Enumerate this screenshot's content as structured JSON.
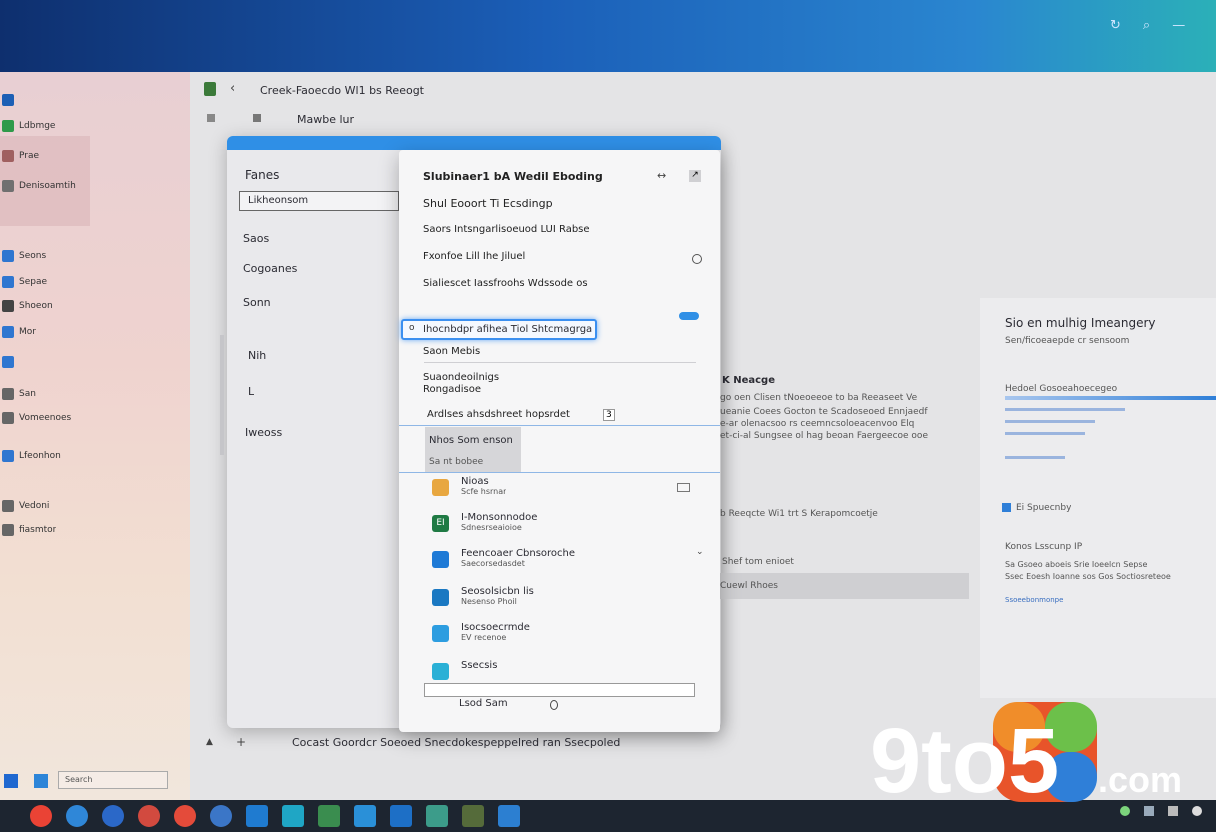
{
  "topbar": {
    "icons": [
      "sync-icon",
      "search-icon",
      "minimize-icon"
    ]
  },
  "left_sidebar": {
    "items": [
      {
        "label": "",
        "color": "#1c5fb5"
      },
      {
        "label": "Ldbmge",
        "color": "#2f9a4a"
      },
      {
        "label": "Prae",
        "color": "#a06060"
      },
      {
        "label": "Denisoamtih",
        "color": "#707070"
      },
      {
        "label": "Seons",
        "color": "#2f76d0"
      },
      {
        "label": "Sepae",
        "color": "#2f76d0"
      },
      {
        "label": "Shoeon",
        "color": "#444"
      },
      {
        "label": "Mor",
        "color": "#2f76d0"
      },
      {
        "label": "",
        "color": "#2f76d0"
      },
      {
        "label": "San",
        "color": "#666"
      },
      {
        "label": "Vomeenoes",
        "color": "#666"
      },
      {
        "label": "Lfeonhon",
        "color": "#2f76d0"
      },
      {
        "label": "Vedoni",
        "color": "#666"
      },
      {
        "label": "fiasmtor",
        "color": "#666"
      }
    ],
    "bottom": {
      "label": "Search",
      "icons": [
        "windows-icon",
        "folder-icon"
      ]
    }
  },
  "window": {
    "address": "Creek-Faoecdo Wl1 bs Reeogt",
    "subnav": "Mawbe lur",
    "status_text": "Cocast Goordcr Soeoed Snecdokespeppelred ran Ssecpoled"
  },
  "settings": {
    "title": "Fanes",
    "field_value": "Likheonsom",
    "items": [
      "Saos",
      "Cogoanes",
      "Sonn",
      "Nih",
      "L",
      "Iweoss"
    ]
  },
  "dialog": {
    "title": "Slubinaer1 bA Wedil Eboding",
    "rows": [
      "Shul Eooort Ti Ecsdingp",
      "Saors Intsngarlisoeuod LUI Rabse",
      "Fxonfoe Lill Ihe Jiluel",
      "Sialiescet Iassfroohs Wdssode os"
    ],
    "search_value": "Ihocnbdpr afihea Tiol Shtcmagrgar",
    "option_rows": [
      "Saon Mebis",
      "Suaondeoilnigs Rongadisoe",
      "Ardlses ahsdshreet hopsrdet"
    ],
    "option_badge": "3",
    "selected": {
      "label": "Nhos Som enson",
      "sub": "Sa nt bobee"
    },
    "apps": [
      {
        "name": "Nioas",
        "sub": "Scfe hsrnar",
        "icon": "folder-icon",
        "color": "#e8a740"
      },
      {
        "name": "I-Monsonnodoe",
        "sub": "Sdnesrseaioioe",
        "icon": "excel-icon",
        "color": "#1f7a44",
        "glyph": "EI"
      },
      {
        "name": "Feencoaer Cbnsoroche",
        "sub": "Saecorsedasdet",
        "icon": "flag-icon",
        "color": "#1e7ad6"
      },
      {
        "name": "Seosolsicbn lis",
        "sub": "Nesenso Phoil",
        "icon": "shield-icon",
        "color": "#1a78c2"
      },
      {
        "name": "Isocsoecrmde",
        "sub": "EV recenoe",
        "icon": "network-icon",
        "color": "#2d9de0"
      },
      {
        "name": "Ssecsis",
        "sub": "",
        "icon": "tablet-icon",
        "color": "#2ab0d6"
      }
    ],
    "bottom_input": "",
    "footer": "Lsod Sam"
  },
  "center_info": {
    "heading": "K Neacge",
    "lines": [
      "go oen Clisen tNoeoeeoe to ba Reeaseet Ve",
      "ueanie Coees Gocton te Scadoseoed Ennjaedf",
      "e-ar olenacsoo rs ceemncsoloeacenvoo Elq",
      "et-ci-al Sungsee ol hag beoan Faergeecoe ooe"
    ],
    "mid": "b Reeqcte Wi1 trt S Kerapomcoetje",
    "sub_head": "Shef tom enioet",
    "sub_item": "Cuewl Rhoes"
  },
  "right_pane": {
    "title": "Sio en mulhig Imeangery",
    "subtitle": "Sen/ficoeaepde cr sensoom",
    "label": "Hedoel Gosoeahoecegeo",
    "toggle_label": "Ei Spuecnby",
    "section": "Konos Lsscunp IP",
    "lines": [
      "Sa Gsoeo aboeis Srie Ioeelcn Sepse",
      "Ssec Eoesh Ioanne sos Gos Soctiosreteoe"
    ],
    "link": "Ssoeebonmonpe"
  },
  "taskbar": {
    "apps": [
      {
        "color": "#ea4335"
      },
      {
        "color": "#2f87d8"
      },
      {
        "color": "#2b68c8"
      },
      {
        "color": "#d24a3f"
      },
      {
        "color": "#e44b3a"
      },
      {
        "color": "#3b76c7"
      },
      {
        "color": "#1f7bd0"
      },
      {
        "color": "#1fa6c5"
      },
      {
        "color": "#3a8d4f"
      },
      {
        "color": "#2a90d8"
      },
      {
        "color": "#1d6fc6"
      },
      {
        "color": "#3c9c8a"
      },
      {
        "color": "#556b3a"
      },
      {
        "color": "#2c7fd1"
      }
    ]
  },
  "watermark": {
    "text_a": "9to5",
    "text_b": ".com"
  }
}
